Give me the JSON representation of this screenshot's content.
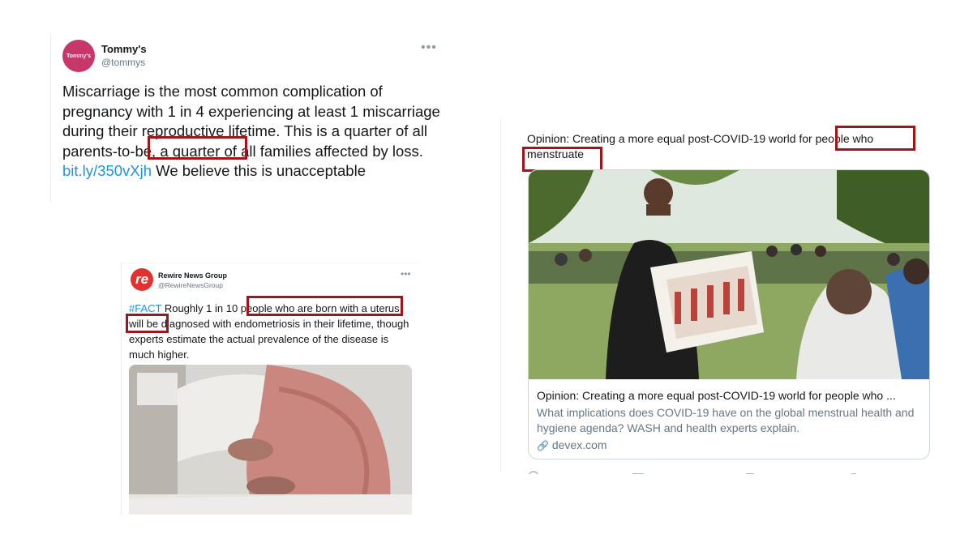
{
  "tommys_tweet": {
    "avatar_text": "Tommy's",
    "name": "Tommy's",
    "handle": "@tommys",
    "more": "•••",
    "text_before": "Miscarriage is the most common complication of pregnancy with 1 in 4 experiencing at least 1 miscarriage during their reproductive lifetime. This is a quarter of all ",
    "text_highlight": "parents-to-be",
    "text_middle": ", a quarter of all families affected by loss. ",
    "link": "bit.ly/350vXjh",
    "text_after": " We believe this is unacceptable"
  },
  "rewire_tweet": {
    "avatar_letter": "re",
    "name": "Rewire News Group",
    "handle": "@RewireNewsGroup",
    "more": "•••",
    "hashtag": "#FACT",
    "text_before": " Roughly 1 in 10 ",
    "highlight_1": "people who are born with a",
    "highlight_2": "uterus",
    "text_after": " will be diagnosed with endometriosis in their lifetime, though experts estimate the actual prevalence of the disease is much higher."
  },
  "devex_tweet": {
    "text_before": "Opinion: Creating a more equal post-COVID-19 world for ",
    "highlight_1": "people who",
    "highlight_2": "menstruate",
    "card": {
      "title": "Opinion: Creating a more equal post-COVID-19 world for people who ...",
      "description": "What implications does COVID-19 have on the global menstrual health and hygiene agenda? WASH and health experts explain.",
      "domain": "devex.com",
      "link_icon": "🔗"
    }
  },
  "colors": {
    "highlight_box": "#a0141a",
    "link": "#1b95e0",
    "tommys_brand": "#c8376a",
    "rewire_brand": "#e0322e"
  },
  "icons": [
    "more-icon",
    "link-icon"
  ]
}
